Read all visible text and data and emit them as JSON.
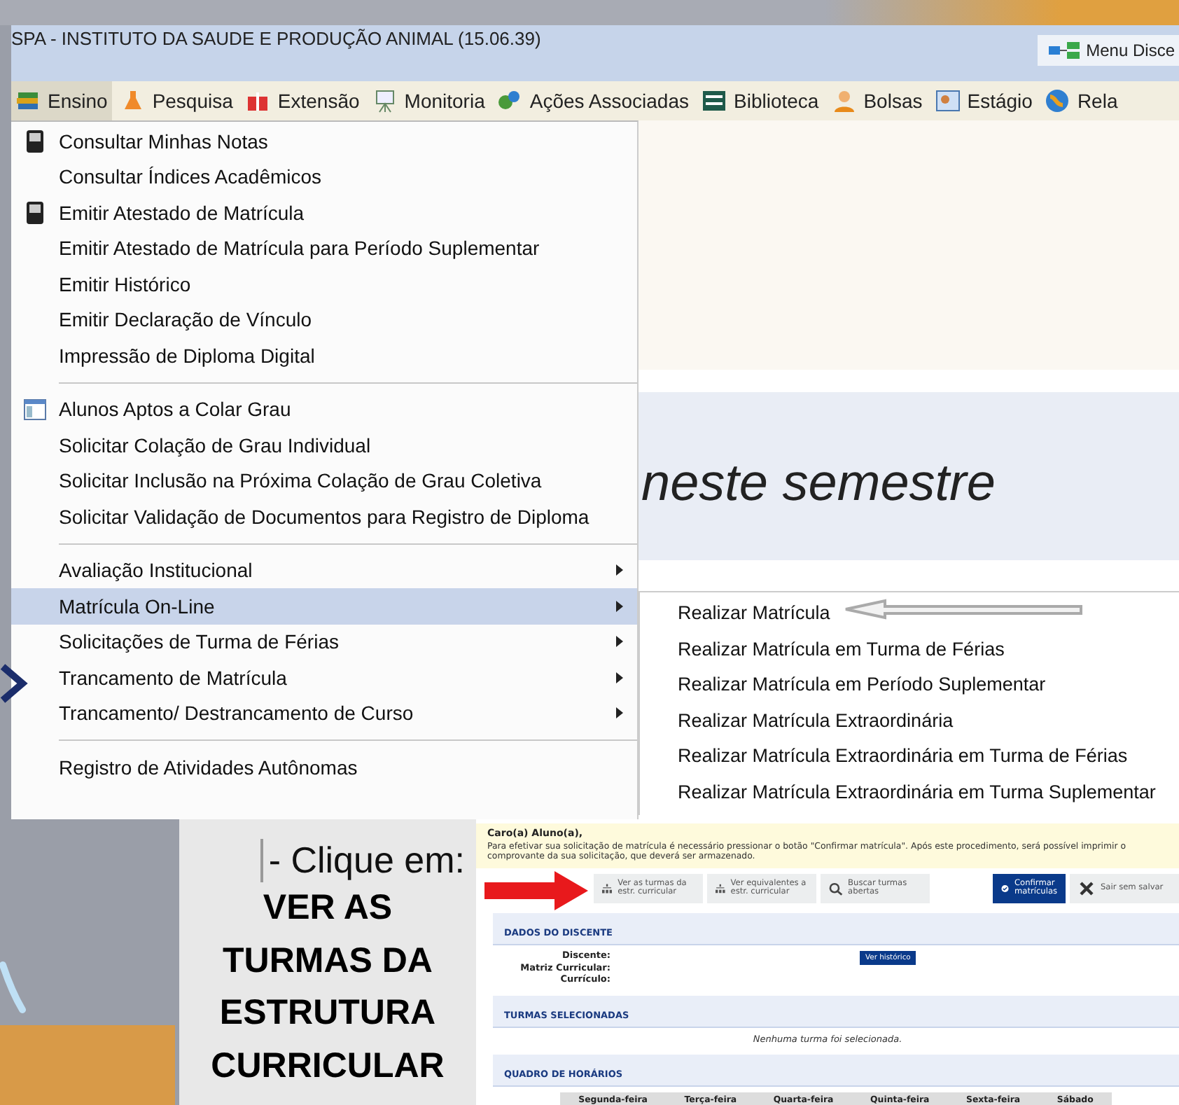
{
  "header": {
    "title": "SPA - INSTITUTO DA SAUDE E PRODUÇÃO ANIMAL (15.06.39)",
    "menu_button": "Menu Disce"
  },
  "menu_bar": [
    {
      "label": "Ensino",
      "selected": true
    },
    {
      "label": "Pesquisa",
      "selected": false
    },
    {
      "label": "Extensão",
      "selected": false
    },
    {
      "label": "Monitoria",
      "selected": false
    },
    {
      "label": "Ações Associadas",
      "selected": false
    },
    {
      "label": "Biblioteca",
      "selected": false
    },
    {
      "label": "Bolsas",
      "selected": false
    },
    {
      "label": "Estágio",
      "selected": false
    },
    {
      "label": "Rela",
      "selected": false
    }
  ],
  "dropdown": {
    "groups": [
      [
        {
          "kind": "device",
          "label": "Consultar Minhas Notas",
          "submenu": false,
          "selected": false
        },
        {
          "kind": "plain",
          "label": "Consultar Índices Acadêmicos",
          "submenu": false,
          "selected": false
        },
        {
          "kind": "device",
          "label": "Emitir Atestado de Matrícula",
          "submenu": false,
          "selected": false
        },
        {
          "kind": "plain",
          "label": "Emitir Atestado de Matrícula para Período Suplementar",
          "submenu": false,
          "selected": false
        },
        {
          "kind": "plain",
          "label": "Emitir Histórico",
          "submenu": false,
          "selected": false
        },
        {
          "kind": "plain",
          "label": "Emitir Declaração de Vínculo",
          "submenu": false,
          "selected": false
        },
        {
          "kind": "plain",
          "label": "Impressão de Diploma Digital",
          "submenu": false,
          "selected": false
        }
      ],
      [
        {
          "kind": "window",
          "label": "Alunos Aptos a Colar Grau",
          "submenu": false,
          "selected": false
        },
        {
          "kind": "plain",
          "label": "Solicitar Colação de Grau Individual",
          "submenu": false,
          "selected": false
        },
        {
          "kind": "plain",
          "label": "Solicitar Inclusão na Próxima Colação de Grau Coletiva",
          "submenu": false,
          "selected": false
        },
        {
          "kind": "plain",
          "label": "Solicitar Validação de Documentos para Registro de Diploma",
          "submenu": false,
          "selected": false
        }
      ],
      [
        {
          "kind": "plain",
          "label": "Avaliação Institucional",
          "submenu": true,
          "selected": false
        },
        {
          "kind": "plain",
          "label": "Matrícula On-Line",
          "submenu": true,
          "selected": true
        },
        {
          "kind": "plain",
          "label": "Solicitações de Turma de Férias",
          "submenu": true,
          "selected": false
        },
        {
          "kind": "plain",
          "label": "Trancamento de Matrícula",
          "submenu": true,
          "selected": false
        },
        {
          "kind": "plain",
          "label": "Trancamento/ Destrancamento de Curso",
          "submenu": true,
          "selected": false
        }
      ],
      [
        {
          "kind": "plain",
          "label": "Registro de Atividades Autônomas",
          "submenu": false,
          "selected": false
        }
      ]
    ]
  },
  "submenu": [
    "Realizar Matrícula",
    "Realizar Matrícula em Turma de Férias",
    "Realizar Matrícula em Período Suplementar",
    "Realizar Matrícula Extraordinária",
    "Realizar Matrícula Extraordinária em Turma de Férias",
    "Realizar Matrícula Extraordinária em Turma Suplementar"
  ],
  "page_heading": "neste semestre",
  "tutorial": {
    "instruction": "- Clique em:",
    "highlight": "VER AS TURMAS DA ESTRUTURA CURRICULAR"
  },
  "enrollment": {
    "notice": {
      "greeting": "Caro(a) Aluno(a),",
      "text": "Para efetivar sua solicitação de matrícula é necessário pressionar o botão \"Confirmar matrícula\". Após este procedimento, será possível imprimir o comprovante da sua solicitação, que deverá ser armazenado."
    },
    "toolbar": [
      {
        "kind": "tree",
        "label": "Ver as turmas da estr. curricular"
      },
      {
        "kind": "tree",
        "label": "Ver equivalentes a estr. curricular"
      },
      {
        "kind": "search",
        "label": "Buscar turmas abertas"
      },
      {
        "kind": "confirm",
        "label": "Confirmar matrículas"
      },
      {
        "kind": "exit",
        "label": "Sair sem salvar"
      }
    ],
    "student_section": {
      "title": "DADOS DO DISCENTE",
      "fields": [
        "Discente:",
        "Matriz Curricular:",
        "Currículo:"
      ],
      "history_button": "Ver histórico"
    },
    "selected_section": {
      "title": "TURMAS SELECIONADAS",
      "empty": "Nenhuma turma foi selecionada."
    },
    "schedule_section": {
      "title": "QUADRO DE HORÁRIOS",
      "columns": [
        "Segunda-feira",
        "Terça-feira",
        "Quarta-feira",
        "Quinta-feira",
        "Sexta-feira",
        "Sábado"
      ]
    }
  }
}
